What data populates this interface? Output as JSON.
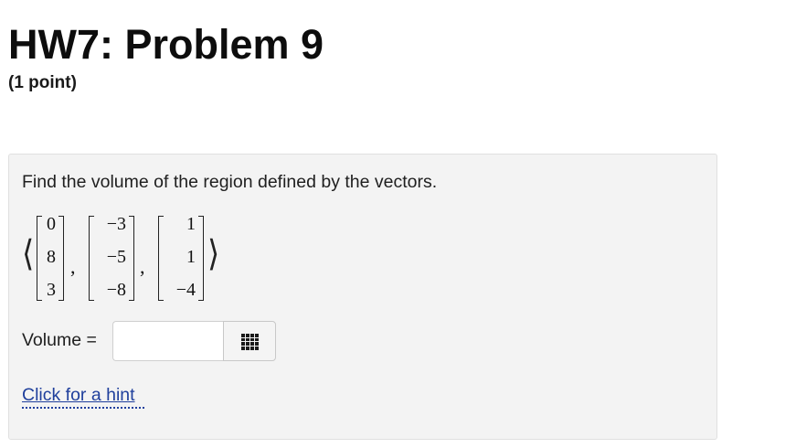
{
  "header": {
    "title": "HW7: Problem 9",
    "points": "(1 point)"
  },
  "problem": {
    "prompt": "Find the volume of the region defined by the vectors.",
    "open_angle": "⟨",
    "close_angle": "⟩",
    "separator": ",",
    "vectors": [
      [
        "0",
        "8",
        "3"
      ],
      [
        "−3",
        "−5",
        "−8"
      ],
      [
        "1",
        "1",
        "−4"
      ]
    ]
  },
  "answer": {
    "label": "Volume =",
    "value": "",
    "palette_icon": "grid-icon"
  },
  "hint": {
    "label": "Click for a hint"
  }
}
